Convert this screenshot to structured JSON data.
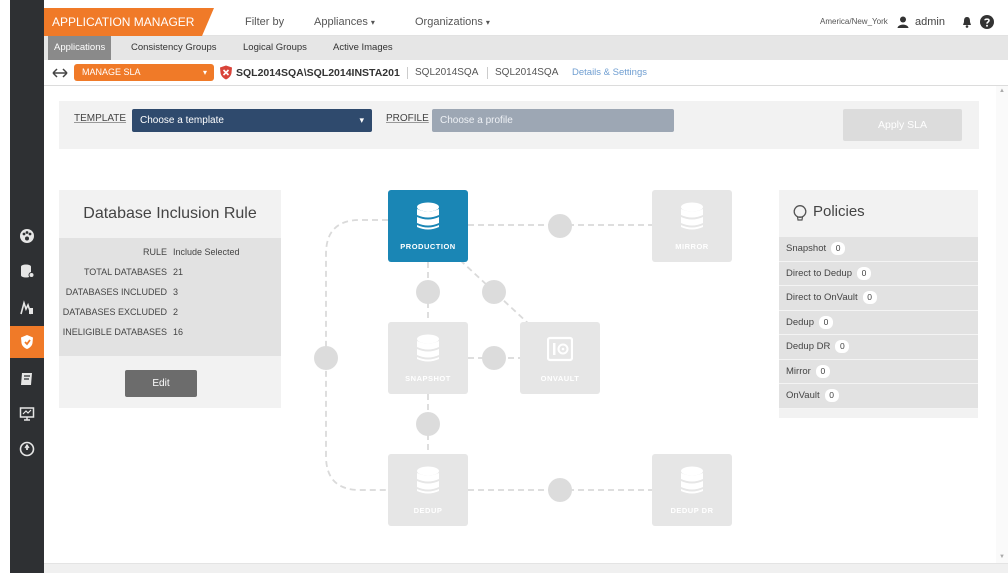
{
  "header": {
    "app_title": "APPLICATION MANAGER",
    "nav": [
      {
        "label": "Filter by",
        "has_caret": false
      },
      {
        "label": "Appliances",
        "has_caret": true
      },
      {
        "label": "Organizations",
        "has_caret": true
      }
    ],
    "timezone": "America/New_York",
    "user": "admin",
    "caret": "▾"
  },
  "subnav": {
    "tabs": [
      "Applications",
      "Consistency Groups",
      "Logical Groups",
      "Active Images"
    ],
    "active": 0
  },
  "breadcrumb": {
    "action_label": "MANAGE SLA",
    "action_caret": "▾",
    "path": "SQL2014SQA\\SQL2014INSTA201",
    "items": [
      "SQL2014SQA",
      "SQL2014SQA"
    ],
    "details_link": "Details & Settings"
  },
  "template_bar": {
    "template_label": "TEMPLATE",
    "template_value": "Choose a template",
    "profile_label": "PROFILE",
    "profile_placeholder": "Choose a profile",
    "apply_label": "Apply SLA",
    "caret": "▾"
  },
  "db_inclusion": {
    "title": "Database Inclusion Rule",
    "rows": [
      {
        "key": "RULE",
        "value": "Include Selected"
      },
      {
        "key": "TOTAL DATABASES",
        "value": "21"
      },
      {
        "key": "DATABASES INCLUDED",
        "value": "3"
      },
      {
        "key": "DATABASES EXCLUDED",
        "value": "2"
      },
      {
        "key": "INELIGIBLE DATABASES",
        "value": "16"
      }
    ],
    "edit_label": "Edit"
  },
  "diagram": {
    "nodes": [
      {
        "id": "production",
        "label": "PRODUCTION",
        "icon": "database-icon",
        "active": true
      },
      {
        "id": "mirror",
        "label": "MIRROR",
        "icon": "database-icon",
        "active": false
      },
      {
        "id": "snapshot",
        "label": "SNAPSHOT",
        "icon": "database-icon",
        "active": false
      },
      {
        "id": "onvault",
        "label": "ONVAULT",
        "icon": "vault-icon",
        "active": false
      },
      {
        "id": "dedup",
        "label": "DEDUP",
        "icon": "database-icon",
        "active": false
      },
      {
        "id": "dedup-dr",
        "label": "DEDUP DR",
        "icon": "database-icon",
        "active": false
      }
    ]
  },
  "policies": {
    "title": "Policies",
    "items": [
      {
        "label": "Snapshot",
        "count": "0"
      },
      {
        "label": "Direct to Dedup",
        "count": "0"
      },
      {
        "label": "Direct to OnVault",
        "count": "0"
      },
      {
        "label": "Dedup",
        "count": "0"
      },
      {
        "label": "Dedup DR",
        "count": "0"
      },
      {
        "label": "Mirror",
        "count": "0"
      },
      {
        "label": "OnVault",
        "count": "0"
      }
    ]
  },
  "rail": {
    "icons": [
      "dashboard-icon",
      "app-manager-icon",
      "monitor-icon",
      "sla-architect-icon",
      "report-icon",
      "domain-manager-icon",
      "power-icon"
    ],
    "active": 3
  },
  "colors": {
    "accent": "#f07a28",
    "rail": "#2e3033",
    "production": "#1a86b5",
    "template_select": "#2f4a6d"
  }
}
